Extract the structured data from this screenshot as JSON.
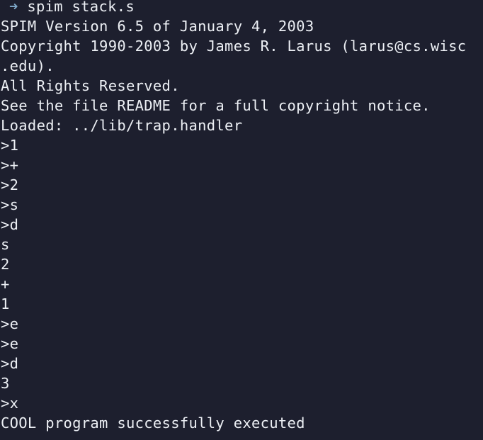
{
  "terminal": {
    "prompt": {
      "arrow": "➜",
      "command": "spim stack.s"
    },
    "lines": [
      "SPIM Version 6.5 of January 4, 2003",
      "Copyright 1990-2003 by James R. Larus (larus@cs.wisc",
      ".edu).",
      "All Rights Reserved.",
      "See the file README for a full copyright notice.",
      "Loaded: ../lib/trap.handler",
      ">1",
      ">+",
      ">2",
      ">s",
      ">d",
      "s",
      "2",
      "+",
      "1",
      ">e",
      ">e",
      ">d",
      "3",
      ">x",
      "COOL program successfully executed"
    ]
  },
  "colors": {
    "background": "#1d1f2e",
    "text": "#eceff4",
    "prompt_arrow": "#7fa8c9"
  }
}
